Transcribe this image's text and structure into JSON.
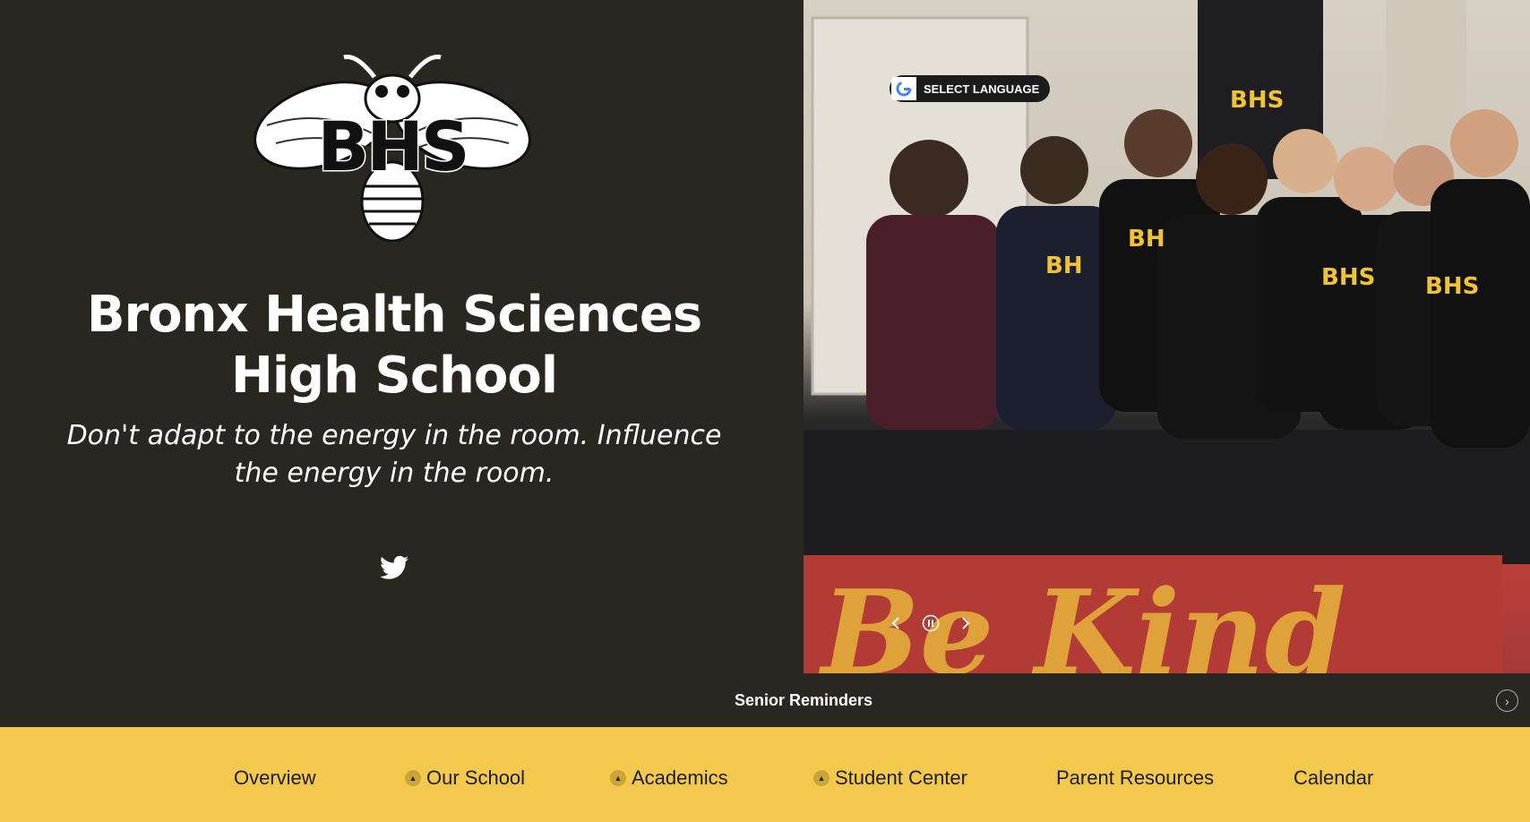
{
  "school": {
    "title": "Bronx Health Sciences High School",
    "tagline": "Don't adapt to the energy in the room. Influence the energy in the room.",
    "logo_text": "BHS"
  },
  "language": {
    "label": "SELECT LANGUAGE"
  },
  "ticker": {
    "text": "Senior Reminders"
  },
  "nav": {
    "items": [
      {
        "label": "Overview",
        "has_submenu": false
      },
      {
        "label": "Our School",
        "has_submenu": true
      },
      {
        "label": "Academics",
        "has_submenu": true
      },
      {
        "label": "Student Center",
        "has_submenu": true
      },
      {
        "label": "Parent Resources",
        "has_submenu": false
      },
      {
        "label": "Calendar",
        "has_submenu": false
      }
    ]
  },
  "photo": {
    "banner_text": "Be Kind"
  },
  "colors": {
    "dark": "#29271f",
    "accent": "#f2c94c"
  }
}
